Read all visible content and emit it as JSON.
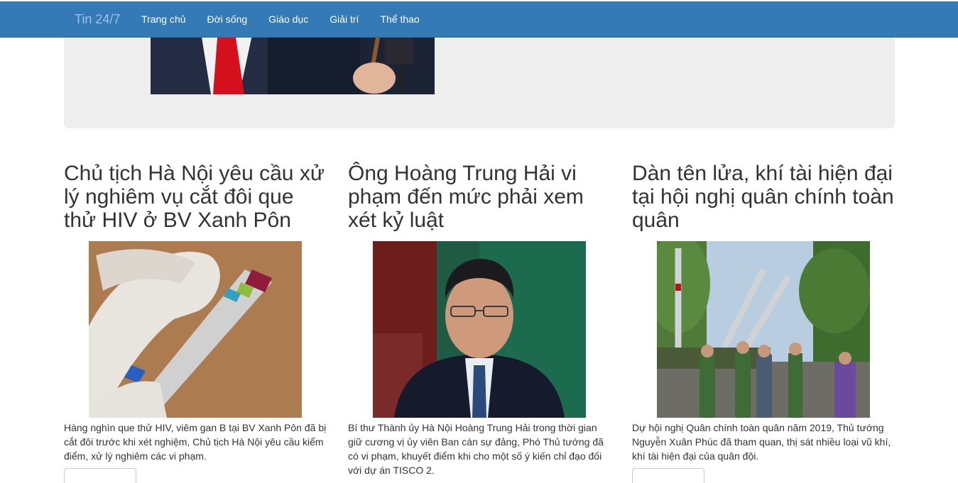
{
  "navbar": {
    "brand": "Tin 24/7",
    "links": [
      "Trang chủ",
      "Đời sống",
      "Giáo dục",
      "Giải trí",
      "Thể thao"
    ]
  },
  "articles": [
    {
      "title": "Chủ tịch Hà Nội yêu cầu xử lý nghiêm vụ cắt đôi que thử HIV ở BV Xanh Pôn",
      "summary": "Hàng nghìn que thử HIV, viêm gan B tại BV Xanh Pôn đã bị cắt đôi trước khi xét nghiệm, Chủ tịch Hà Nội yêu cầu kiểm điểm, xử lý nghiêm các vi phạm."
    },
    {
      "title": "Ông Hoàng Trung Hải vi phạm đến mức phải xem xét kỷ luật",
      "summary": "Bí thư Thành ủy Hà Nội Hoàng Trung Hải trong thời gian giữ cương vị ủy viên Ban cán sự đảng, Phó Thủ tướng đã có vi phạm, khuyết điểm khi cho một số ý kiến chỉ đạo đối với dự án TISCO 2."
    },
    {
      "title": "Dàn tên lửa, khí tài hiện đại tại hội nghị quân chính toàn quân",
      "summary": "Dự hội nghị Quân chính toàn quân năm 2019, Thủ tướng Nguyễn Xuân Phúc đã tham quan, thị sát nhiều loại vũ khí, khí tài hiện đại của quân đội."
    }
  ]
}
